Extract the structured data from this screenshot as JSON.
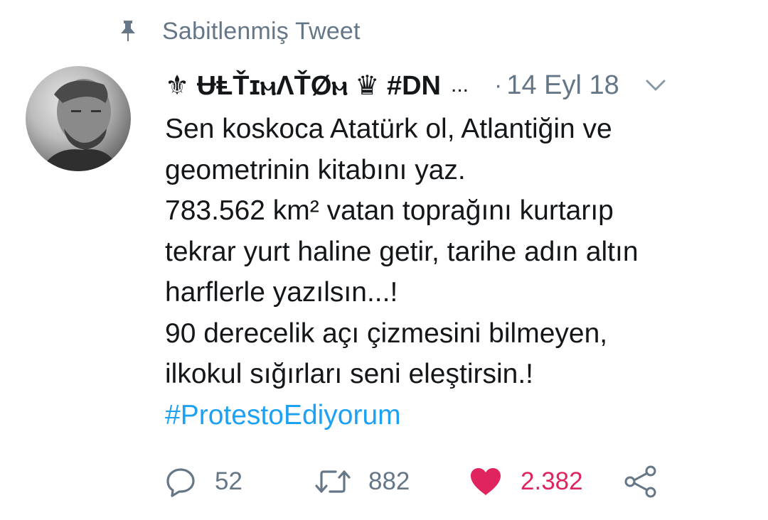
{
  "pinned": {
    "label": "Sabitlenmiş Tweet",
    "icon": "pin-icon"
  },
  "tweet": {
    "display_name": "⚜ ɄⱠŤɪⲙɅŤØⲙ ♛ #DN",
    "truncation": "...",
    "separator": "·",
    "date": "14 Eyl 18",
    "text_lines": [
      "Sen koskoca Atatürk ol, Atlantiğin ve",
      "geometrinin kitabını yaz.",
      "783.562 km² vatan toprağını kurtarıp",
      "tekrar yurt haline getir, tarihe adın altın",
      "harflerle yazılsın...!",
      "90 derecelik açı çizmesini bilmeyen,",
      "ilkokul sığırları seni eleştirsin.!"
    ],
    "hashtag": "#ProtestoEdiyorum"
  },
  "actions": {
    "reply_count": "52",
    "retweet_count": "882",
    "like_count": "2.382"
  },
  "colors": {
    "text": "#14171a",
    "secondary": "#657786",
    "link": "#1da1f2",
    "like": "#e0245e"
  }
}
